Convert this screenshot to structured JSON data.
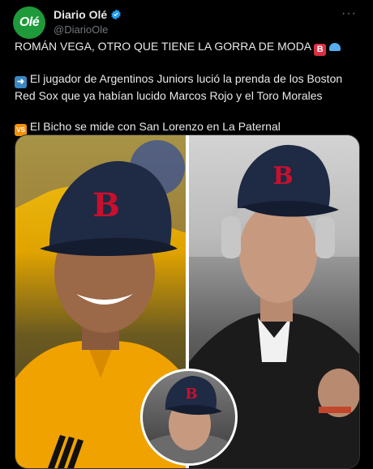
{
  "account": {
    "avatar_text": "Olé",
    "display_name": "Diario Olé",
    "handle": "@DiarioOle",
    "more_label": "···",
    "colors": {
      "avatar_bg": "#1e9a3a",
      "verified": "#1d9bf0"
    }
  },
  "tweet": {
    "headline": "ROMÁN VEGA, OTRO QUE TIENE LA GORRA DE MODA",
    "headline_emoji_letter": "B",
    "para1": "El jugador de Argentinos Juniors lució la prenda de los Boston Red Sox que ya habían lucido Marcos Rojo y el Toro Morales",
    "para2": "El Bicho se mide con San Lorenzo en La Paternal",
    "vs_emoji_label": "VS"
  },
  "media": {
    "left_photo": "player-in-yellow-jacket-with-red-sox-cap",
    "right_photo": "player-with-headphones-and-red-sox-cap",
    "inset_photo": "player-close-up-with-red-sox-cap",
    "cap_logo_letter": "B",
    "colors": {
      "cap": "#1f2a44",
      "logo": "#c8102e"
    }
  }
}
